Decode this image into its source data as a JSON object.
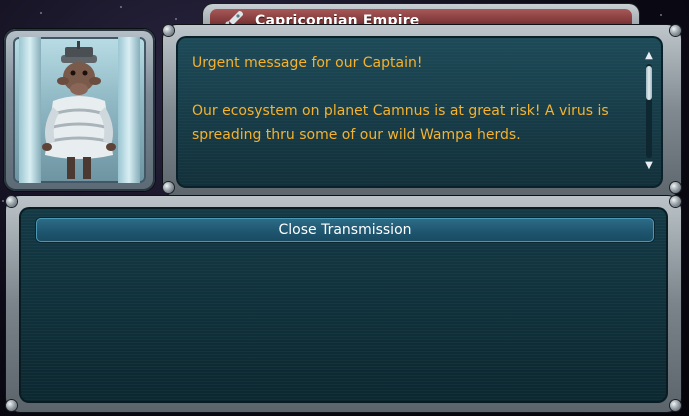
{
  "window": {
    "title": "Capricornian Empire",
    "title_icon": "rocket-icon"
  },
  "portrait": {
    "icon": "alien-captain-portrait"
  },
  "message": {
    "paragraphs": [
      "Urgent message for our Captain!",
      "Our ecosystem on planet Camnus is at great risk! A virus is spreading thru some of our wild Wampa herds."
    ]
  },
  "scrollbar": {
    "up_icon": "arrow-up-icon",
    "down_icon": "arrow-down-icon"
  },
  "actions": {
    "close_label": "Close Transmission"
  },
  "colors": {
    "message_text": "#f6b22d",
    "title_bar": "#7a3434",
    "panel_bg": "#1e4a58",
    "button_bg": "#1f5670"
  }
}
